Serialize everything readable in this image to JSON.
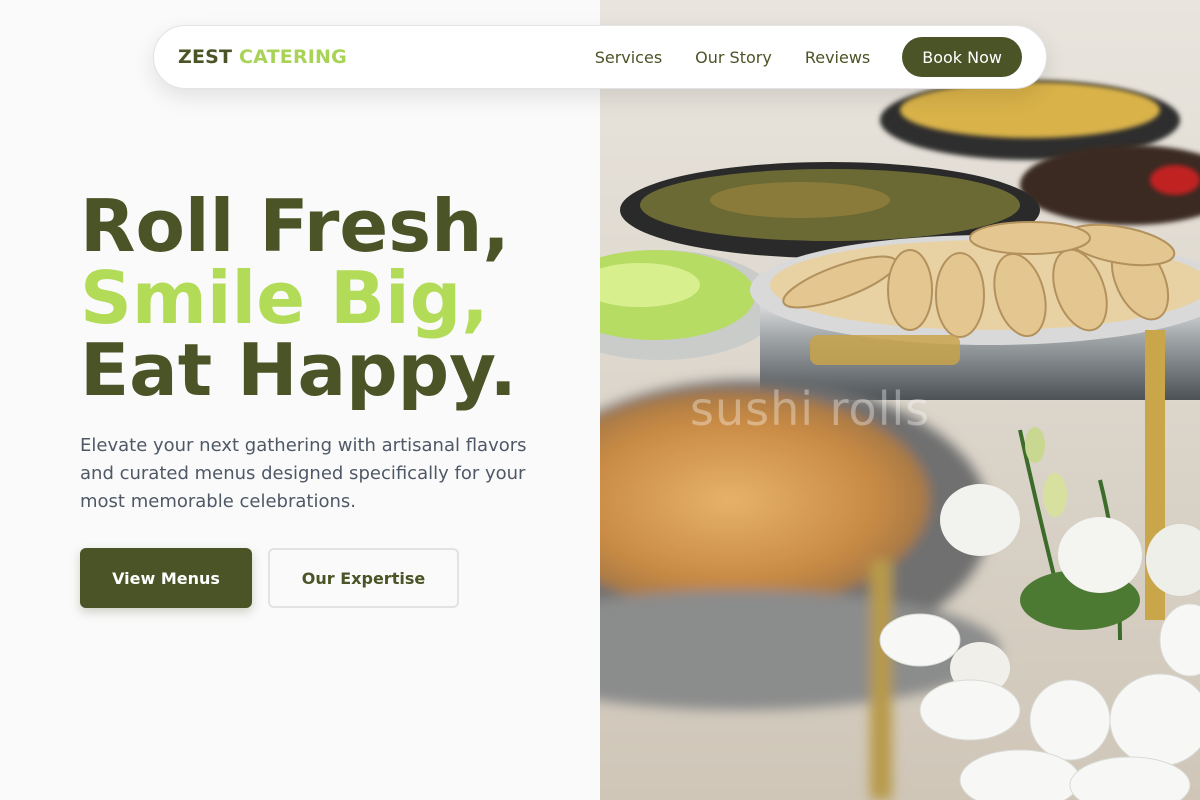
{
  "brand": {
    "part1": "ZEST",
    "part2": "CATERING"
  },
  "nav": {
    "links": [
      {
        "label": "Services"
      },
      {
        "label": "Our Story"
      },
      {
        "label": "Reviews"
      }
    ],
    "cta": "Book Now"
  },
  "hero": {
    "line1": "Roll Fresh,",
    "line2": "Smile Big,",
    "line3": "Eat Happy.",
    "description": "Elevate your next gathering with artisanal flavors and curated menus designed specifically for your most memorable celebrations.",
    "primary_button": "View Menus",
    "secondary_button": "Our Expertise"
  },
  "photo": {
    "watermark": "sushi rolls"
  },
  "colors": {
    "accent_dark": "#4a5426",
    "accent_light": "#b2db58",
    "body_text": "#4e5866"
  }
}
